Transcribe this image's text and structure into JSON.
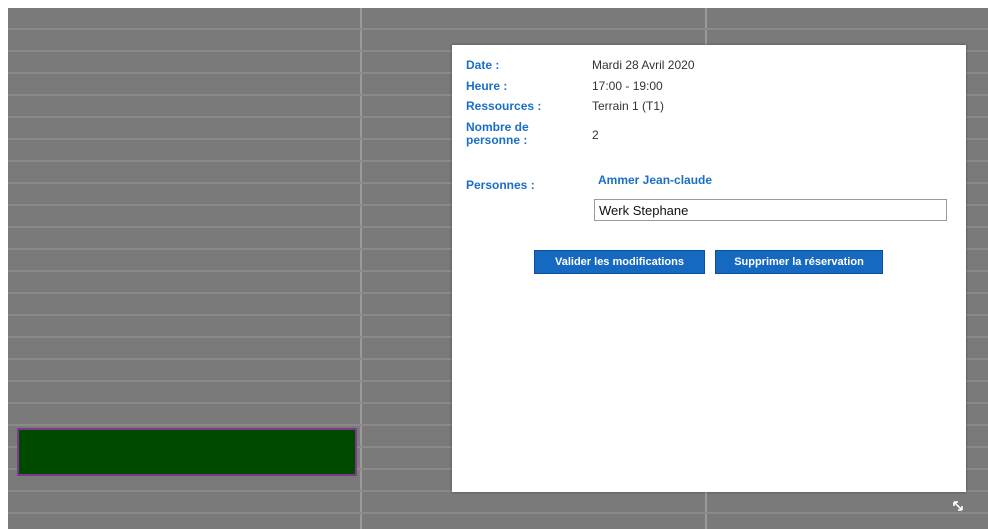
{
  "colors": {
    "overlay": "#7a7a7a",
    "event_fill": "#004a00",
    "event_border": "#7b3a8c",
    "label_blue": "#1a6ec8",
    "button_blue": "#1669c1"
  },
  "details": {
    "date_label": "Date :",
    "date_value": "Mardi 28 Avril 2020",
    "hours_label": "Heure :",
    "hours_value": "17:00 - 19:00",
    "resources_label": "Ressources :",
    "resources_value": "Terrain 1 (T1)",
    "people_count_label": "Nombre de personne :",
    "people_count_value": "2"
  },
  "persons": {
    "label": "Personnes :",
    "first_person": "Ammer Jean-claude",
    "second_person_value": "Werk Stephane"
  },
  "actions": {
    "validate_label": "Valider les modifications",
    "delete_label": "Supprimer la réservation"
  },
  "icons": {
    "resize": "resize-handle-icon"
  }
}
